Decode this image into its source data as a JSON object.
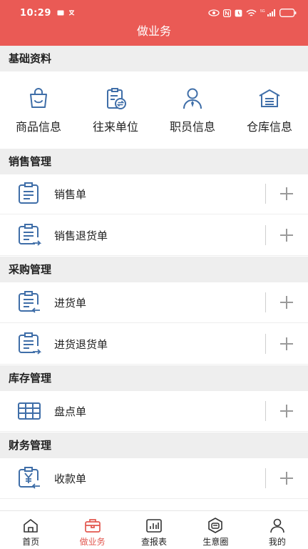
{
  "status_bar": {
    "time": "10:29",
    "network_label": "5G"
  },
  "header": {
    "title": "做业务"
  },
  "basic_info": {
    "section_title": "基础资料",
    "items": [
      {
        "label": "商品信息",
        "icon": "shopping-bag-icon"
      },
      {
        "label": "往来单位",
        "icon": "exchange-document-icon"
      },
      {
        "label": "职员信息",
        "icon": "person-icon"
      },
      {
        "label": "仓库信息",
        "icon": "warehouse-icon"
      }
    ]
  },
  "sales": {
    "section_title": "销售管理",
    "items": [
      {
        "label": "销售单",
        "icon": "clipboard-list-icon"
      },
      {
        "label": "销售退货单",
        "icon": "clipboard-return-icon"
      }
    ]
  },
  "purchase": {
    "section_title": "采购管理",
    "items": [
      {
        "label": "进货单",
        "icon": "clipboard-in-icon"
      },
      {
        "label": "进货退货单",
        "icon": "clipboard-out-icon"
      }
    ]
  },
  "inventory": {
    "section_title": "库存管理",
    "items": [
      {
        "label": "盘点单",
        "icon": "table-grid-icon"
      }
    ]
  },
  "finance": {
    "section_title": "财务管理",
    "items": [
      {
        "label": "收款单",
        "icon": "yuan-receipt-icon"
      }
    ]
  },
  "tabbar": {
    "active": "做业务",
    "tabs": [
      {
        "label": "首页",
        "icon": "home-icon"
      },
      {
        "label": "做业务",
        "icon": "briefcase-icon"
      },
      {
        "label": "查报表",
        "icon": "bar-chart-icon"
      },
      {
        "label": "生意圈",
        "icon": "circle-chat-icon"
      },
      {
        "label": "我的",
        "icon": "user-icon"
      }
    ]
  },
  "colors": {
    "header_bg": "#ea5a55",
    "icon_blue": "#3f6ea8",
    "active_tab": "#e2574f",
    "section_bg": "#eeeeee"
  }
}
